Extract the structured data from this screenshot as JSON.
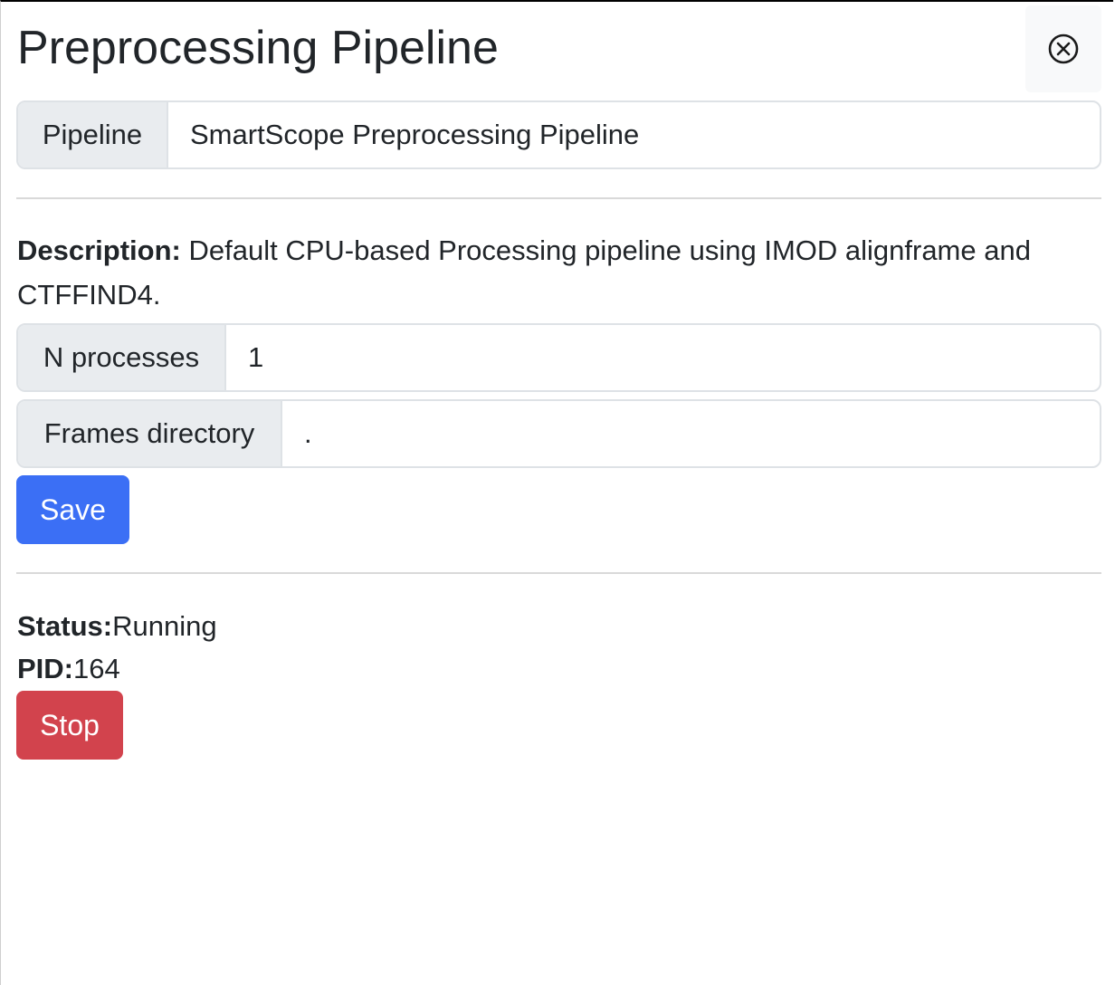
{
  "header": {
    "title": "Preprocessing Pipeline",
    "close_icon": "circle-x-icon"
  },
  "pipeline": {
    "label": "Pipeline",
    "value": "SmartScope Preprocessing Pipeline"
  },
  "description": {
    "label": "Description:",
    "text": "Default CPU-based Processing pipeline using IMOD alignframe and CTFFIND4."
  },
  "form": {
    "n_processes": {
      "label": "N processes",
      "value": "1"
    },
    "frames_directory": {
      "label": "Frames directory",
      "value": "."
    },
    "save_label": "Save"
  },
  "status": {
    "status_label": "Status:",
    "status_value": "Running",
    "pid_label": "PID:",
    "pid_value": "164",
    "stop_label": "Stop"
  },
  "colors": {
    "primary": "#3b6ff5",
    "danger": "#d2434d",
    "label_bg": "#e9ecef",
    "border": "#dee2e6"
  }
}
